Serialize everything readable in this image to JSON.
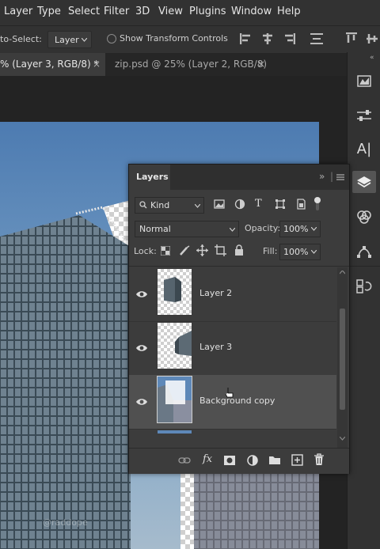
{
  "menubar": {
    "items": [
      "Layer",
      "Type",
      "Select",
      "Filter",
      "3D",
      "View",
      "Plugins",
      "Window",
      "Help"
    ]
  },
  "options": {
    "auto_select_label": "to-Select:",
    "auto_select_value": "Layer",
    "transform_controls_label": "Show Transform Controls"
  },
  "tabs": [
    {
      "label": "% (Layer 3, RGB/8) *",
      "close": "×"
    },
    {
      "label": "zip.psd @ 25% (Layer 2, RGB/8)",
      "close": "×"
    }
  ],
  "watermark": "@raddope",
  "layers_panel": {
    "title": "Layers",
    "filter_kind": "Kind",
    "blend_mode": "Normal",
    "opacity_label": "Opacity:",
    "opacity_value": "100%",
    "lock_label": "Lock:",
    "fill_label": "Fill:",
    "fill_value": "100%",
    "layers": [
      {
        "name": "Layer 2",
        "visible": true
      },
      {
        "name": "Layer 3",
        "visible": true
      },
      {
        "name": "Background copy",
        "visible": true,
        "selected": true
      },
      {
        "name": "",
        "visible": false
      }
    ],
    "footer_icons": [
      "link-icon",
      "fx-icon",
      "mask-icon",
      "adjustment-icon",
      "folder-icon",
      "new-layer-icon",
      "trash-icon"
    ],
    "fx_label": "fx"
  },
  "right_dock": [
    "histogram-icon",
    "adjustments-icon",
    "character-icon",
    "layers-icon",
    "channels-icon",
    "paths-icon",
    "history-icon"
  ],
  "colors": {
    "panel_bg": "#3c3c3c",
    "selected_row": "#505050",
    "sky": "#4d7bb1"
  }
}
